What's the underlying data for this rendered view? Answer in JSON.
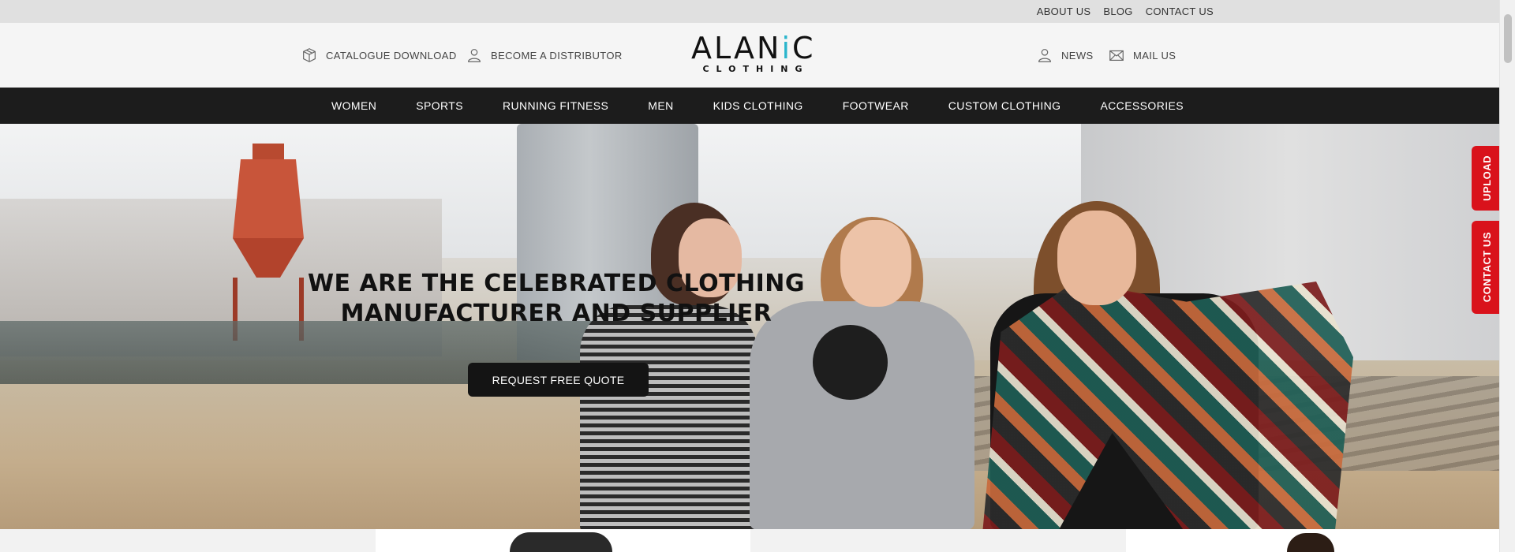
{
  "topbar": {
    "links": [
      "ABOUT US",
      "BLOG",
      "CONTACT US"
    ]
  },
  "header": {
    "left_items": [
      {
        "label": "CATALOGUE DOWNLOAD",
        "icon": "box-icon"
      },
      {
        "label": "BECOME A DISTRIBUTOR",
        "icon": "user-icon"
      }
    ],
    "logo": {
      "word_part1": "ALAN",
      "word_accent": "i",
      "word_part2": "C",
      "sub": "CLOTHING"
    },
    "right_items": [
      {
        "label": "NEWS",
        "icon": "user-icon"
      },
      {
        "label": "MAIL US",
        "icon": "mail-icon"
      }
    ]
  },
  "nav": {
    "items": [
      "WOMEN",
      "SPORTS",
      "RUNNING FITNESS",
      "MEN",
      "KIDS CLOTHING",
      "FOOTWEAR",
      "CUSTOM CLOTHING",
      "ACCESSORIES"
    ]
  },
  "hero": {
    "title_line1": "WE ARE THE CELEBRATED CLOTHING",
    "title_line2": "MANUFACTURER AND SUPPLIER",
    "cta_label": "REQUEST FREE QUOTE"
  },
  "side_tabs": {
    "upload": "UPLOAD",
    "contact": "CONTACT US"
  },
  "colors": {
    "accent_red": "#d9121b",
    "nav_bg": "#1c1c1c",
    "logo_accent": "#2bb5cc"
  }
}
